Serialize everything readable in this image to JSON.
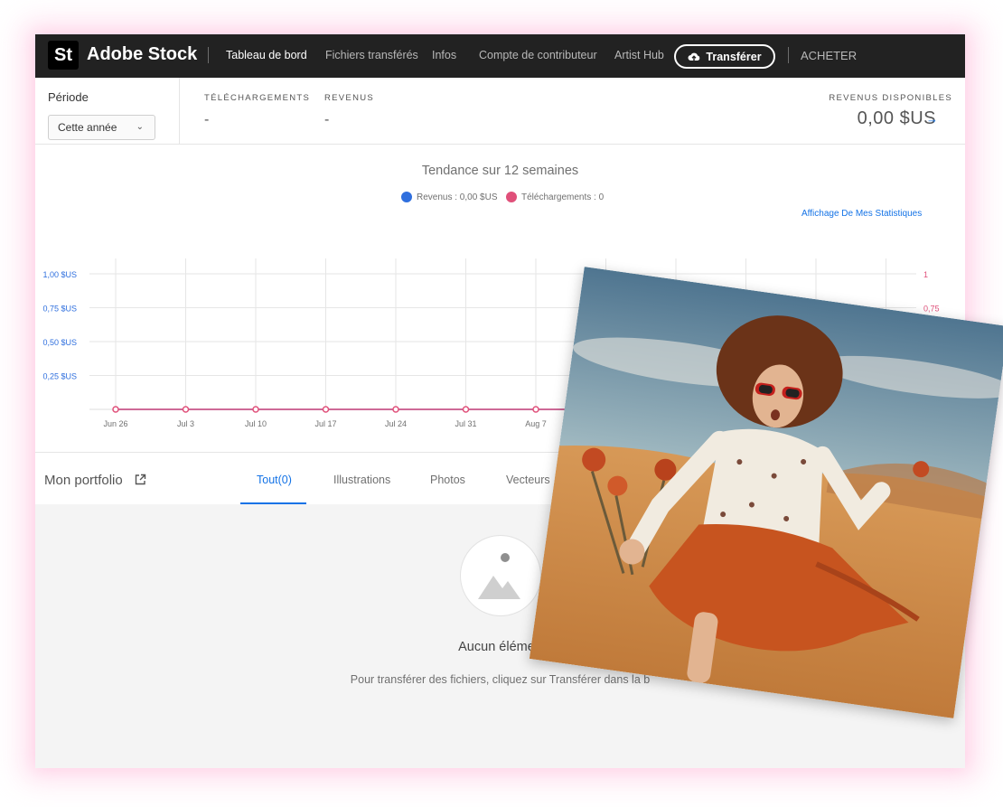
{
  "nav": {
    "logo": "St",
    "brand": "Adobe Stock",
    "links": [
      "Tableau de bord",
      "Fichiers transférés",
      "Infos",
      "Compte de contributeur",
      "Artist Hub"
    ],
    "upload_label": "Transférer",
    "buy_label": "ACHETER"
  },
  "stats": {
    "period_label": "Période",
    "period_value": "Cette année",
    "downloads_label": "TÉLÉCHARGEMENTS",
    "downloads_value": "-",
    "revenue_label": "REVENUS",
    "revenue_value": "-",
    "available_label": "REVENUS DISPONIBLES",
    "available_value": "0,00 $US",
    "available_arrow": "→"
  },
  "chart": {
    "title": "Tendance sur 12 semaines",
    "legend_revenue": "Revenus : 0,00 $US",
    "legend_downloads": "Téléchargements : 0",
    "stats_link": "Affichage De Mes Statistiques"
  },
  "chart_data": {
    "type": "line",
    "title": "Tendance sur 12 semaines",
    "x": [
      "Jun 26",
      "Jul 3",
      "Jul 10",
      "Jul 17",
      "Jul 24",
      "Jul 31",
      "Aug 7",
      "",
      "",
      "",
      "",
      ""
    ],
    "series": [
      {
        "name": "Revenus : 0,00 $US",
        "values": [
          0,
          0,
          0,
          0,
          0,
          0,
          0,
          0,
          0,
          0,
          0,
          0
        ],
        "color": "#2f6fde",
        "axis": "left"
      },
      {
        "name": "Téléchargements : 0",
        "values": [
          0,
          0,
          0,
          0,
          0,
          0,
          0,
          0,
          0,
          0,
          0,
          0
        ],
        "color": "#e0507a",
        "axis": "right"
      }
    ],
    "y_left_ticks": [
      "0,25 $US",
      "0,50 $US",
      "0,75 $US",
      "1,00 $US"
    ],
    "y_left_values": [
      0.25,
      0.5,
      0.75,
      1.0
    ],
    "y_right_ticks": [
      "0,75",
      "1"
    ],
    "y_right_values": [
      0.75,
      1.0
    ],
    "ylim": [
      0,
      1
    ],
    "grid": true
  },
  "portfolio": {
    "title": "Mon portfolio",
    "tabs": [
      "Tout(0)",
      "Illustrations",
      "Photos",
      "Vecteurs"
    ],
    "empty_title": "Aucun élémen",
    "empty_desc": "Pour transférer des fichiers, cliquez sur Transférer dans la b"
  },
  "colors": {
    "nav_bg": "#222222",
    "accent": "#1473e6",
    "revenue": "#2f6fde",
    "downloads": "#e0507a"
  }
}
